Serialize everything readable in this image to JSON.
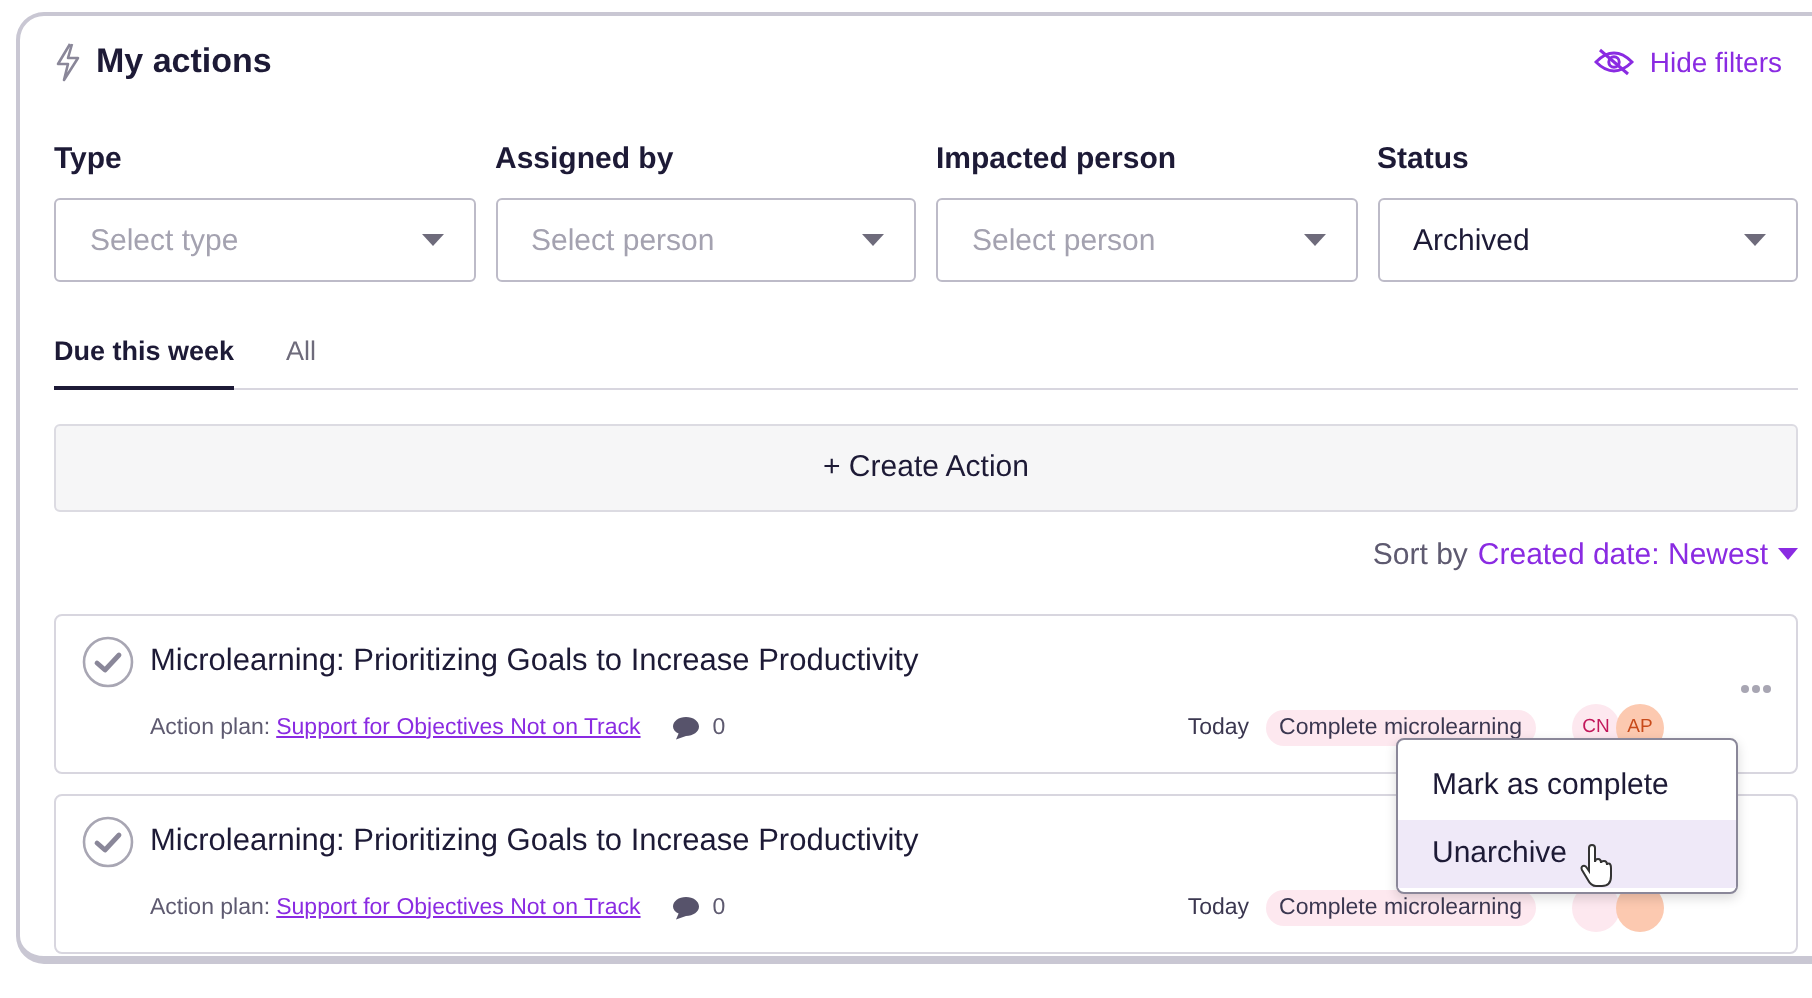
{
  "header": {
    "title": "My actions",
    "hide_filters": "Hide filters"
  },
  "filters": [
    {
      "label": "Type",
      "placeholder": "Select type"
    },
    {
      "label": "Assigned by",
      "placeholder": "Select person"
    },
    {
      "label": "Impacted person",
      "placeholder": "Select person"
    },
    {
      "label": "Status",
      "value": "Archived"
    }
  ],
  "tabs": [
    {
      "label": "Due this week",
      "selected": true
    },
    {
      "label": "All",
      "selected": false
    }
  ],
  "create_button": "+ Create Action",
  "sort": {
    "label": "Sort by",
    "value": "Created date: Newest"
  },
  "actions": [
    {
      "title": "Microlearning: Prioritizing Goals to Increase Productivity",
      "plan_label": "Action plan:",
      "plan_link": "Support for Objectives Not on Track",
      "comments": "0",
      "due": "Today",
      "tag": "Complete microlearning",
      "avatars": [
        {
          "initials": "CN",
          "color": "#fde8ef"
        },
        {
          "initials": "AP",
          "color": "#fcc9b0"
        }
      ]
    },
    {
      "title": "Microlearning: Prioritizing Goals to Increase Productivity",
      "plan_label": "Action plan:",
      "plan_link": "Support for Objectives Not on Track",
      "comments": "0",
      "due": "Today",
      "tag": "Complete microlearning",
      "avatars": [
        {
          "color": "#fde8ef"
        },
        {
          "color": "#fcc9b0"
        }
      ]
    }
  ],
  "menu": {
    "items": [
      {
        "label": "Mark as complete",
        "selected": false
      },
      {
        "label": "Unarchive",
        "selected": true
      }
    ]
  }
}
